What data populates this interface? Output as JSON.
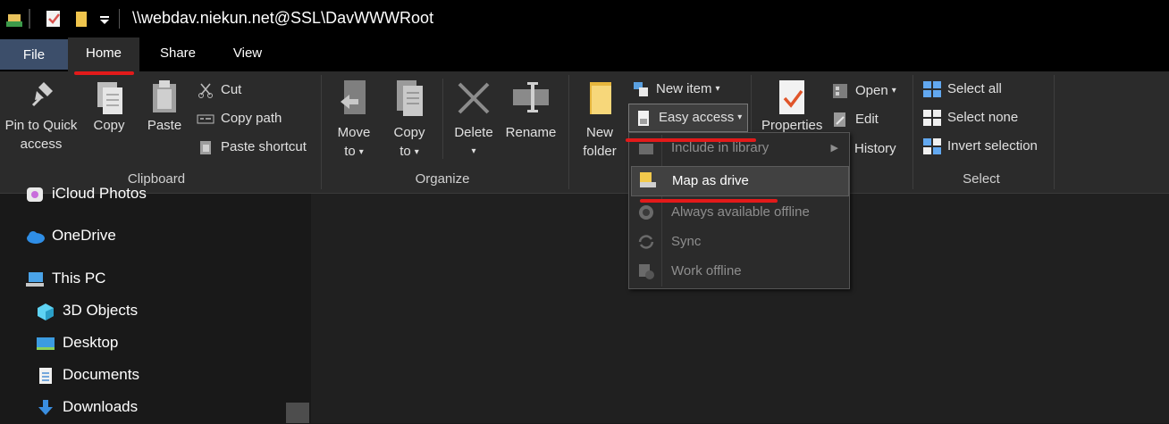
{
  "window": {
    "path": "\\\\webdav.niekun.net@SSL\\DavWWWRoot"
  },
  "tabs": {
    "file": "File",
    "home": "Home",
    "share": "Share",
    "view": "View"
  },
  "ribbon": {
    "clipboard": {
      "label": "Clipboard",
      "pin_line1": "Pin to Quick",
      "pin_line2": "access",
      "copy": "Copy",
      "paste": "Paste",
      "cut": "Cut",
      "copy_path": "Copy path",
      "paste_shortcut": "Paste shortcut"
    },
    "organize": {
      "label": "Organize",
      "move_line1": "Move",
      "move_line2": "to",
      "copy_line1": "Copy",
      "copy_line2": "to",
      "delete": "Delete",
      "rename": "Rename"
    },
    "new": {
      "new_folder_line1": "New",
      "new_folder_line2": "folder",
      "new_item": "New item",
      "easy_access": "Easy access"
    },
    "open": {
      "properties_partial": "Properties",
      "open": "Open",
      "edit": "Edit",
      "history": "History"
    },
    "select": {
      "label": "Select",
      "select_all": "Select all",
      "select_none": "Select none",
      "invert": "Invert selection"
    }
  },
  "easy_access_menu": {
    "include_in_library": "Include in library",
    "map_as_drive": "Map as drive",
    "always_available_offline": "Always available offline",
    "sync": "Sync",
    "work_offline": "Work offline"
  },
  "nav": {
    "icloud": "iCloud Photos",
    "onedrive": "OneDrive",
    "this_pc": "This PC",
    "objects3d": "3D Objects",
    "desktop": "Desktop",
    "documents": "Documents",
    "downloads": "Downloads"
  },
  "colors": {
    "file_tab": "#3c4e6a",
    "annotation_red": "#e31a1a",
    "ribbon_bg": "#2b2b2b",
    "title_bg": "#000000"
  }
}
